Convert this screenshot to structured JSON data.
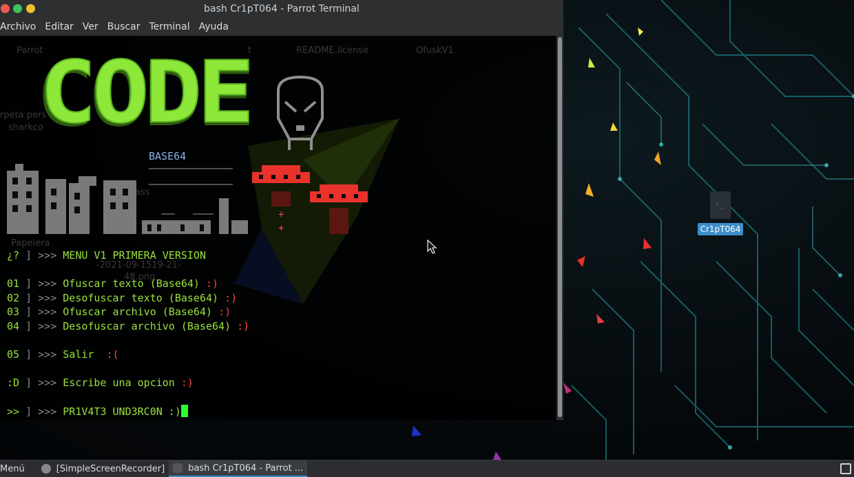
{
  "window": {
    "title": "bash Cr1pT064 - Parrot Terminal",
    "menu": [
      "Archivo",
      "Editar",
      "Ver",
      "Buscar",
      "Terminal",
      "Ayuda"
    ]
  },
  "ghost_desktop": {
    "items": [
      "Parrot",
      "t",
      "README.license",
      "OfuskV1",
      "rpeta pers",
      "sharkco",
      "ass",
      "Papelera",
      "-2021-09-1519-21-",
      "48.png"
    ]
  },
  "art": {
    "logo_text": "CODE",
    "base64_label": "BASE64",
    "plus_marks": [
      "+",
      "+"
    ]
  },
  "terminal_lines": [
    {
      "prefix": "¿?",
      "bracket": "]",
      "arrows": ">>>",
      "text": "MENU V1 PRIMERA VERSION",
      "smile": ""
    },
    {
      "prefix": "01",
      "bracket": "]",
      "arrows": ">>>",
      "text": "Ofuscar texto (Base64)",
      "smile": ":)"
    },
    {
      "prefix": "02",
      "bracket": "]",
      "arrows": ">>>",
      "text": "Desofuscar texto (Base64)",
      "smile": ":)"
    },
    {
      "prefix": "03",
      "bracket": "]",
      "arrows": ">>>",
      "text": "Ofuscar archivo (Base64)",
      "smile": ":)"
    },
    {
      "prefix": "04",
      "bracket": "]",
      "arrows": ">>>",
      "text": "Desofuscar archivo (Base64)",
      "smile": ":)"
    },
    {
      "prefix": "05",
      "bracket": "]",
      "arrows": ">>>",
      "text": "Salir  ",
      "smile": ":("
    },
    {
      "prefix": ":D",
      "bracket": "]",
      "arrows": ">>>",
      "text": "Escribe una opcion",
      "smile": ":)"
    },
    {
      "prefix": ">>",
      "bracket": "]",
      "arrows": ">>>",
      "text": "PR1V4T3 UND3RC0N :)",
      "smile": ""
    }
  ],
  "desktop": {
    "selected_icon_label": "Cr1pT064"
  },
  "taskbar": {
    "menu_label": "Menú",
    "tasks": [
      "[SimpleScreenRecorder]",
      "bash Cr1pT064 - Parrot ..."
    ]
  },
  "colors": {
    "accent": "#3d8ec9",
    "terminal_green": "#9ae23c",
    "smile_red": "#ff4444",
    "logo_green": "#8ee83a",
    "ufo_red": "#e8322c"
  }
}
